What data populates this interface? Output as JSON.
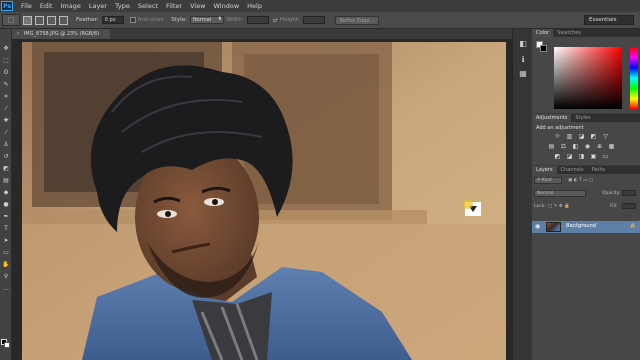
{
  "app": {
    "logo": "Ps",
    "menu": [
      "File",
      "Edit",
      "Image",
      "Layer",
      "Type",
      "Select",
      "Filter",
      "View",
      "Window",
      "Help"
    ]
  },
  "options": {
    "feather_label": "Feather:",
    "feather_value": "0 px",
    "antialias_label": "Anti-alias",
    "style_label": "Style:",
    "style_value": "Normal",
    "width_label": "Width:",
    "height_label": "Height:",
    "refine_label": "Refine Edge...",
    "workspace": "Essentials"
  },
  "document": {
    "tab_title": "IMG_8758.JPG @ 23% (RGB/8)",
    "close": "×"
  },
  "panels": {
    "color_tabs": [
      "Color",
      "Swatches"
    ],
    "adjust_tabs": [
      "Adjustments",
      "Styles"
    ],
    "adjust_title": "Add an adjustment",
    "layers_tabs": [
      "Layers",
      "Channels",
      "Paths"
    ],
    "kind_label": "Kind",
    "blend_mode": "Normal",
    "opacity_label": "Opacity:",
    "lock_label": "Lock:",
    "fill_label": "Fill:",
    "layer_name": "Background"
  },
  "colors": {
    "accent": "#5e7fa6",
    "ui_dark": "#3c3c3c",
    "fg": "#000000",
    "bg": "#ffffff"
  }
}
